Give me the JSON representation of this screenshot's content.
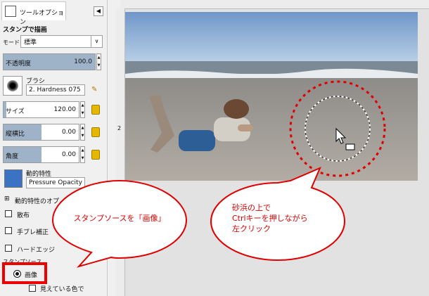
{
  "tab": {
    "label": "ツールオプション",
    "config_button": "◀"
  },
  "tool": {
    "title": "スタンプで描画"
  },
  "mode": {
    "label": "モード:",
    "value": "標準"
  },
  "opacity": {
    "label": "不透明度",
    "value": "100.0",
    "fraction": 1.0
  },
  "brush": {
    "label": "ブラシ",
    "name": "2. Hardness 075"
  },
  "size": {
    "label": "サイズ",
    "value": "120.00",
    "fraction": 0.04
  },
  "aspect": {
    "label": "縦横比",
    "value": "0.00",
    "fraction": 0.5
  },
  "angle": {
    "label": "角度",
    "value": "0.00",
    "fraction": 0.5
  },
  "dynamics": {
    "label": "動的特性",
    "name": "Pressure Opacity"
  },
  "options": {
    "dynamics_options": "動的特性のオプ",
    "scatter": "散布",
    "smooth": "手ブレ補正",
    "hard_edge": "ハードエッジ",
    "source_label": "スタンプソース",
    "source_image": "画像",
    "sample_merged": "見えている色で"
  },
  "ruler": {
    "mark": "2"
  },
  "callouts": {
    "left": "スタンプソースを「画像」",
    "right_line1": "砂浜の上で",
    "right_line2": "Ctrlキーを押しながら",
    "right_line3": "左クリック"
  },
  "colors": {
    "accent_red": "#e00000",
    "slider_fill": "#9fb3c8",
    "sky": "#8fb0d6",
    "sand": "#a7a29c"
  }
}
